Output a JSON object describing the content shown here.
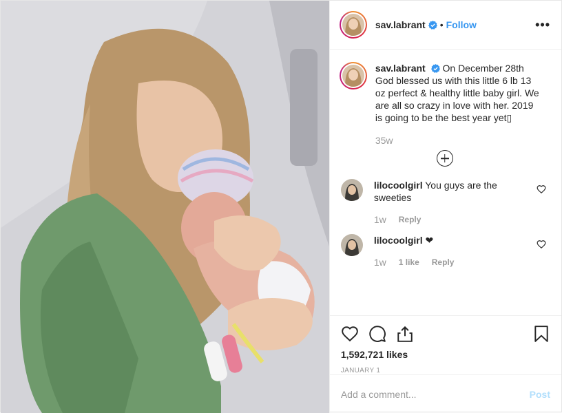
{
  "post": {
    "username": "sav.labrant",
    "separator": "•",
    "follow_label": "Follow",
    "more_label": "•••",
    "caption": "On December 28th God blessed us with this little 6 lb 13 oz perfect & healthy little baby girl. We are all so crazy in love with her. 2019 is going to be the best year yet",
    "caption_trailing_glyph": "▯",
    "caption_time": "35w",
    "likes": "1,592,721 likes",
    "date": "JANUARY 1",
    "add_comment_placeholder": "Add a comment...",
    "post_label": "Post"
  },
  "comments": [
    {
      "user": "lilocoolgirl",
      "text": "You guys are the sweeties",
      "time": "1w",
      "reply_label": "Reply"
    },
    {
      "user": "lilocoolgirl",
      "text": "❤",
      "time": "1w",
      "likes_label": "1 like",
      "reply_label": "Reply"
    }
  ],
  "colors": {
    "link_blue": "#3897f0",
    "verified_blue": "#3897f0",
    "muted": "#999999",
    "post_disabled": "#b2dffc"
  },
  "icons": [
    "verified-badge-icon",
    "more-options-icon",
    "load-more-comments-icon",
    "heart-icon",
    "comment-icon",
    "share-icon",
    "bookmark-icon"
  ]
}
